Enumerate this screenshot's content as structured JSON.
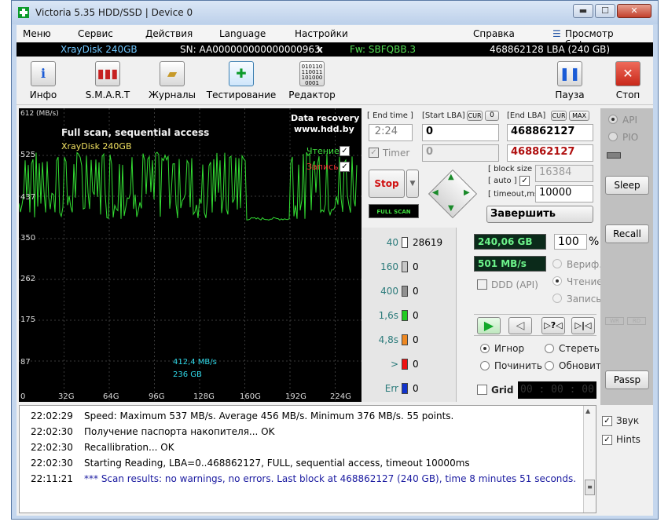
{
  "window": {
    "title": "Victoria 5.35 HDD/SSD | Device 0",
    "min": "▬",
    "max": "☐",
    "close": "✕"
  },
  "menu": {
    "items": [
      "Меню",
      "Сервис",
      "Действия",
      "Language",
      "Настройки",
      "Справка"
    ],
    "buffer": "Просмотр буфера"
  },
  "infobar": {
    "model": "XrayDisk 240GB",
    "sn": "SN: AA000000000000000963",
    "x": "x",
    "fw": "Fw: SBFQBB.3",
    "lba": "468862128 LBA (240 GB)"
  },
  "toolbar": {
    "info": "Инфо",
    "smart": "S.M.A.R.T",
    "logs": "Журналы",
    "test": "Тестирование",
    "editor": "Редактор",
    "pause": "Пауза",
    "stop": "Стоп"
  },
  "graph": {
    "ymax_label": "612 (MB/s)",
    "yticks": [
      "525",
      "437",
      "350",
      "262",
      "175",
      "87"
    ],
    "xticks": [
      "0",
      "32G",
      "64G",
      "96G",
      "128G",
      "160G",
      "192G",
      "224G"
    ],
    "headline": "Full scan, sequential access",
    "device": "XrayDisk 240GB",
    "brand1": "Data recovery",
    "brand2": "www.hdd.by",
    "read_label": "Чтение",
    "write_label": "Запись",
    "speed_now": "412,4 MB/s",
    "pos_now": "236 GB",
    "colors": {
      "line": "#33dd33",
      "grid": "#3a3a3a",
      "text": "#00e0e0"
    },
    "chart_data": {
      "type": "line",
      "ylim": [
        0,
        612
      ],
      "xlim": [
        0,
        240
      ],
      "ylabel": "(MB/s)",
      "note": "green speed trace, mostly oscillating 380-530 MB/s with a flat ~380 segment around 150-175 GB"
    }
  },
  "controls": {
    "end_time_label": "[ End time ]",
    "start_lba_label": "[Start LBA]",
    "cur1": "CUR",
    "zero": "0",
    "end_lba_label": "[End LBA]",
    "cur2": "CUR",
    "max": "MAX",
    "end_time": "2:24",
    "start_lba": "0",
    "end_lba": "468862127",
    "timer_label": "Timer",
    "timer_val": "0",
    "end_lba2": "468862127",
    "stop_btn": "Stop",
    "full_scan": "FULL SCAN",
    "block_size_label": "[ block size ]",
    "auto_label": "[ auto ]",
    "block_size": "16384",
    "timeout_label": "[ timeout,ms ]",
    "timeout": "10000",
    "finish": "Завершить"
  },
  "stats": {
    "rows": [
      {
        "label": "40",
        "count": "28619",
        "color": "#ffffff"
      },
      {
        "label": "160",
        "count": "0",
        "color": "#c8c8c8"
      },
      {
        "label": "400",
        "count": "0",
        "color": "#909090"
      },
      {
        "label": "1,6s",
        "count": "0",
        "color": "#22cc22"
      },
      {
        "label": "4,8s",
        "count": "0",
        "color": "#ee8822"
      },
      {
        "label": ">",
        "count": "0",
        "color": "#ee1111"
      },
      {
        "label": "Err",
        "count": "0",
        "color": "#1133cc"
      }
    ],
    "gb_done": "240,06 GB",
    "percent": "100",
    "pct_sign": "%",
    "speed": "501 MB/s",
    "ddd": "DDD (API)",
    "verify": "Вериф.",
    "read": "Чтение",
    "write": "Запись",
    "ignore": "Игнор",
    "erase": "Стереть",
    "repair": "Починить",
    "refresh": "Обновить",
    "grid": "Grid",
    "clock": "00 : 00 : 00"
  },
  "right": {
    "api": "API",
    "pio": "PIO",
    "sleep": "Sleep",
    "recall": "Recall",
    "passp": "Passp",
    "wr": "WR",
    "rd": "RD"
  },
  "log": [
    {
      "time": "22:02:29",
      "text": "Speed: Maximum 537 MB/s. Average 456 MB/s. Minimum 376 MB/s. 55 points.",
      "color": "#000000"
    },
    {
      "time": "22:02:30",
      "text": "Получение паспорта накопителя... OK",
      "color": "#000000"
    },
    {
      "time": "22:02:30",
      "text": "Recallibration... OK",
      "color": "#000000"
    },
    {
      "time": "22:02:30",
      "text": "Starting Reading, LBA=0..468862127, FULL, sequential access, timeout 10000ms",
      "color": "#000000"
    },
    {
      "time": "22:11:21",
      "text": "*** Scan results: no warnings, no errors. Last block at 468862127 (240 GB), time 8 minutes 51 seconds.",
      "color": "#1a1aa0"
    }
  ],
  "bottomright": {
    "sound": "Звук",
    "hints": "Hints"
  }
}
